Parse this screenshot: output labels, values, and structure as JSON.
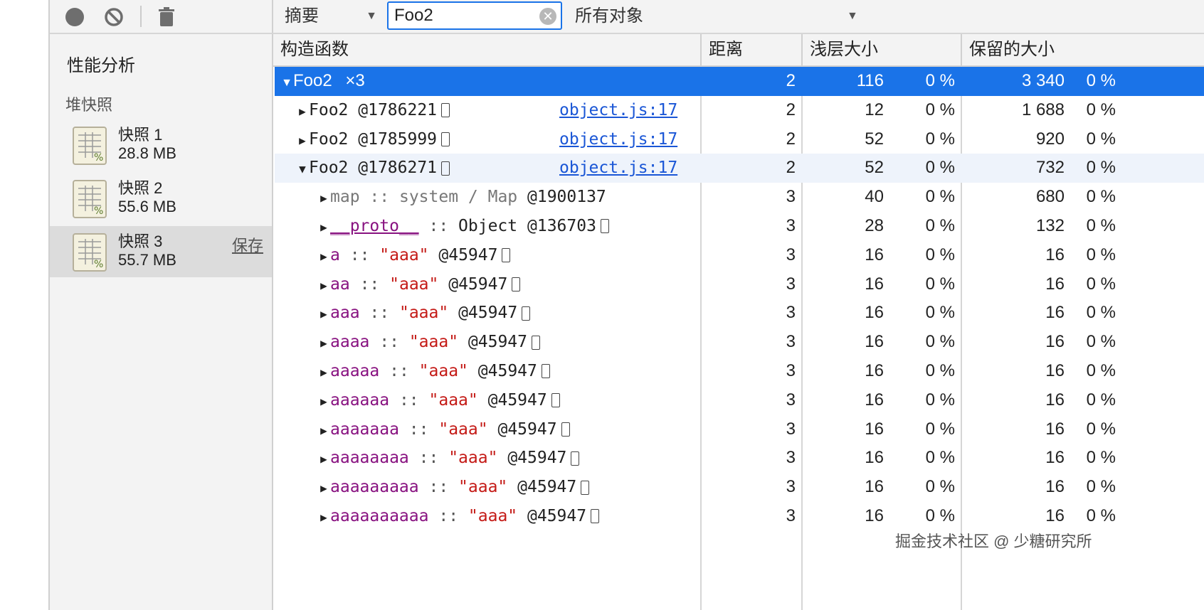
{
  "toolbar": {
    "record_icon": "record-icon",
    "clear_icon": "clear-icon",
    "trash_icon": "trash-icon"
  },
  "sidebar": {
    "title": "性能分析",
    "group": "堆快照",
    "snapshots": [
      {
        "name": "快照 1",
        "size": "28.8 MB"
      },
      {
        "name": "快照 2",
        "size": "55.6 MB"
      },
      {
        "name": "快照 3",
        "size": "55.7 MB",
        "action": "保存"
      }
    ]
  },
  "filter": {
    "view": "摘要",
    "search_value": "Foo2",
    "objects": "所有对象"
  },
  "columns": {
    "constructor": "构造函数",
    "distance": "距离",
    "shallow": "浅层大小",
    "retained": "保留的大小"
  },
  "group_row": {
    "name": "Foo2",
    "count": "×3",
    "distance": "2",
    "shallow": "116",
    "shallow_pct": "0 %",
    "retained": "3 340",
    "retained_pct": "0 %"
  },
  "instances": [
    {
      "name": "Foo2",
      "id": "@1786221",
      "link": "object.js:17",
      "distance": "2",
      "shallow": "12",
      "shallow_pct": "0 %",
      "retained": "1 688",
      "retained_pct": "0 %"
    },
    {
      "name": "Foo2",
      "id": "@1785999",
      "link": "object.js:17",
      "distance": "2",
      "shallow": "52",
      "shallow_pct": "0 %",
      "retained": "920",
      "retained_pct": "0 %"
    },
    {
      "name": "Foo2",
      "id": "@1786271",
      "link": "object.js:17",
      "distance": "2",
      "shallow": "52",
      "shallow_pct": "0 %",
      "retained": "732",
      "retained_pct": "0 %"
    }
  ],
  "children": [
    {
      "prop": "map",
      "sep": "::",
      "type": "system / Map",
      "id": "@1900137",
      "distance": "3",
      "shallow": "40",
      "shallow_pct": "0 %",
      "retained": "680",
      "retained_pct": "0 %"
    },
    {
      "prop": "__proto__",
      "sep": "::",
      "type": "Object",
      "id": "@136703",
      "distance": "3",
      "shallow": "28",
      "shallow_pct": "0 %",
      "retained": "132",
      "retained_pct": "0 %"
    },
    {
      "prop": "a",
      "sep": "::",
      "value": "\"aaa\"",
      "id": "@45947",
      "distance": "3",
      "shallow": "16",
      "shallow_pct": "0 %",
      "retained": "16",
      "retained_pct": "0 %"
    },
    {
      "prop": "aa",
      "sep": "::",
      "value": "\"aaa\"",
      "id": "@45947",
      "distance": "3",
      "shallow": "16",
      "shallow_pct": "0 %",
      "retained": "16",
      "retained_pct": "0 %"
    },
    {
      "prop": "aaa",
      "sep": "::",
      "value": "\"aaa\"",
      "id": "@45947",
      "distance": "3",
      "shallow": "16",
      "shallow_pct": "0 %",
      "retained": "16",
      "retained_pct": "0 %"
    },
    {
      "prop": "aaaa",
      "sep": "::",
      "value": "\"aaa\"",
      "id": "@45947",
      "distance": "3",
      "shallow": "16",
      "shallow_pct": "0 %",
      "retained": "16",
      "retained_pct": "0 %"
    },
    {
      "prop": "aaaaa",
      "sep": "::",
      "value": "\"aaa\"",
      "id": "@45947",
      "distance": "3",
      "shallow": "16",
      "shallow_pct": "0 %",
      "retained": "16",
      "retained_pct": "0 %"
    },
    {
      "prop": "aaaaaa",
      "sep": "::",
      "value": "\"aaa\"",
      "id": "@45947",
      "distance": "3",
      "shallow": "16",
      "shallow_pct": "0 %",
      "retained": "16",
      "retained_pct": "0 %"
    },
    {
      "prop": "aaaaaaa",
      "sep": "::",
      "value": "\"aaa\"",
      "id": "@45947",
      "distance": "3",
      "shallow": "16",
      "shallow_pct": "0 %",
      "retained": "16",
      "retained_pct": "0 %"
    },
    {
      "prop": "aaaaaaaa",
      "sep": "::",
      "value": "\"aaa\"",
      "id": "@45947",
      "distance": "3",
      "shallow": "16",
      "shallow_pct": "0 %",
      "retained": "16",
      "retained_pct": "0 %"
    },
    {
      "prop": "aaaaaaaaa",
      "sep": "::",
      "value": "\"aaa\"",
      "id": "@45947",
      "distance": "3",
      "shallow": "16",
      "shallow_pct": "0 %",
      "retained": "16",
      "retained_pct": "0 %"
    },
    {
      "prop": "aaaaaaaaaa",
      "sep": "::",
      "value": "\"aaa\"",
      "id": "@45947",
      "distance": "3",
      "shallow": "16",
      "shallow_pct": "0 %",
      "retained": "16",
      "retained_pct": "0 %"
    }
  ],
  "watermark": "掘金技术社区 @ 少糖研究所",
  "colors": {
    "accent": "#1a73e8",
    "property": "#881280",
    "string": "#c41a16",
    "link": "#1a56d6"
  }
}
